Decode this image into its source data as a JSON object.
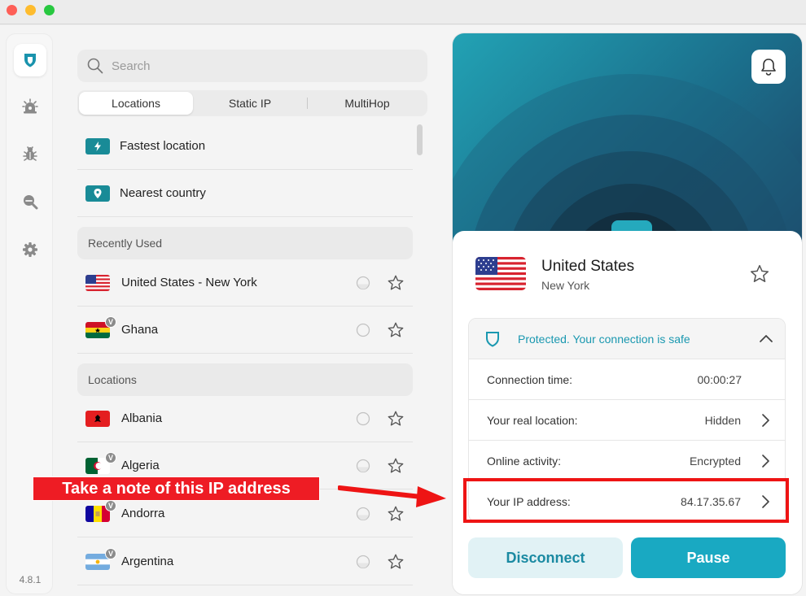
{
  "window": {
    "controls": [
      "close",
      "minimize",
      "maximize"
    ]
  },
  "rail": {
    "items": [
      {
        "name": "vpn-shield-icon",
        "active": true
      },
      {
        "name": "threat-protection-icon",
        "active": false
      },
      {
        "name": "bug-icon",
        "active": false
      },
      {
        "name": "scan-icon",
        "active": false
      },
      {
        "name": "settings-icon",
        "active": false
      }
    ],
    "version": "4.8.1"
  },
  "search": {
    "placeholder": "Search"
  },
  "tabs": [
    {
      "label": "Locations",
      "active": true
    },
    {
      "label": "Static IP",
      "active": false
    },
    {
      "label": "MultiHop",
      "active": false
    }
  ],
  "quick": [
    {
      "label": "Fastest location",
      "icon": "bolt-icon"
    },
    {
      "label": "Nearest country",
      "icon": "pin-icon"
    }
  ],
  "recent": {
    "header": "Recently Used",
    "items": [
      {
        "label": "United States - New York",
        "flag": "us",
        "badge": false
      },
      {
        "label": "Ghana",
        "flag": "gh",
        "badge": true,
        "badge_text": "V"
      }
    ]
  },
  "locations": {
    "header": "Locations",
    "items": [
      {
        "label": "Albania",
        "flag": "al",
        "badge": false
      },
      {
        "label": "Algeria",
        "flag": "dz",
        "badge": true,
        "badge_text": "V"
      },
      {
        "label": "Andorra",
        "flag": "ad",
        "badge": true,
        "badge_text": "V"
      },
      {
        "label": "Argentina",
        "flag": "ar",
        "badge": true,
        "badge_text": "V"
      }
    ]
  },
  "connection": {
    "country": "United States",
    "city": "New York",
    "status": "Protected. Your connection is safe",
    "rows": [
      {
        "label": "Connection time:",
        "value": "00:00:27",
        "arrow": false
      },
      {
        "label": "Your real location:",
        "value": "Hidden",
        "arrow": true
      },
      {
        "label": "Online activity:",
        "value": "Encrypted",
        "arrow": true
      },
      {
        "label": "Your IP address:",
        "value": "84.17.35.67",
        "arrow": true
      }
    ],
    "disconnect_label": "Disconnect",
    "pause_label": "Pause"
  },
  "annotation": {
    "text": "Take a note of this IP address",
    "color": "#ee1c24"
  },
  "colors": {
    "accent": "#19a9c2",
    "accent_dark": "#1a8aa2",
    "status": "#1a98b0"
  }
}
